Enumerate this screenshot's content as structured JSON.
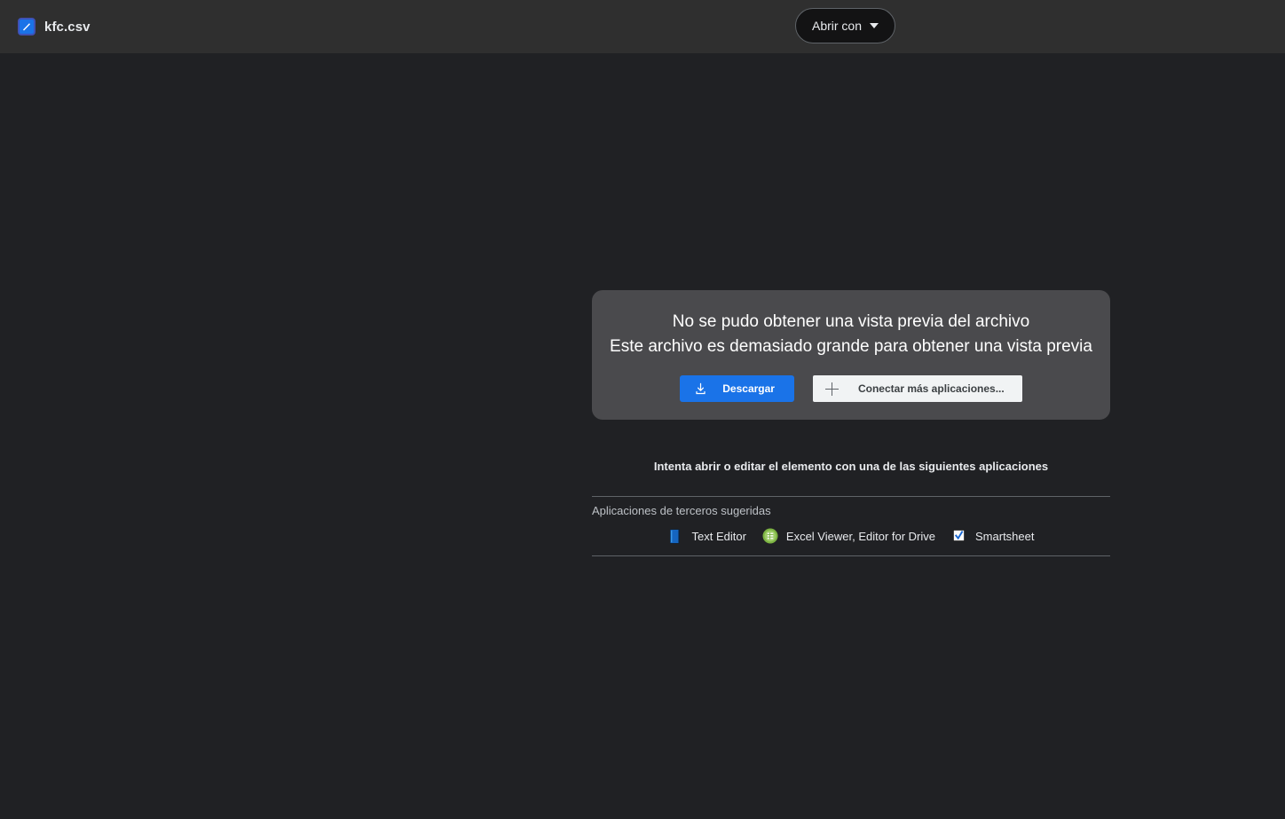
{
  "header": {
    "file_icon_name": "csv-file-icon",
    "file_title": "kfc.csv",
    "open_with_label": "Abrir con",
    "caret_icon_name": "chevron-down-icon"
  },
  "preview": {
    "message_line1": "No se pudo obtener una vista previa del archivo",
    "message_line2": "Este archivo es demasiado grande para obtener una vista previa",
    "download_label": "Descargar",
    "download_icon_name": "download-icon",
    "connect_label": "Conectar más aplicaciones...",
    "connect_icon_name": "plus-icon"
  },
  "apps": {
    "hint": "Intenta abrir o editar el elemento con una de las siguientes aplicaciones",
    "third_party_label": "Aplicaciones de terceros sugeridas",
    "items": [
      {
        "name": "Text Editor",
        "icon": "text-editor-icon"
      },
      {
        "name": "Excel Viewer, Editor for Drive",
        "icon": "excel-viewer-icon"
      },
      {
        "name": "Smartsheet",
        "icon": "smartsheet-icon"
      }
    ]
  },
  "colors": {
    "page_background": "#202124",
    "header_background": "#2f2f2f",
    "card_background": "#4a4a4d",
    "accent_blue": "#1a73e8",
    "divider": "#5f6368",
    "light_button": "#f1f3f4",
    "excel_green": "#7cb342",
    "text_editor_blue": "#1565c0"
  }
}
